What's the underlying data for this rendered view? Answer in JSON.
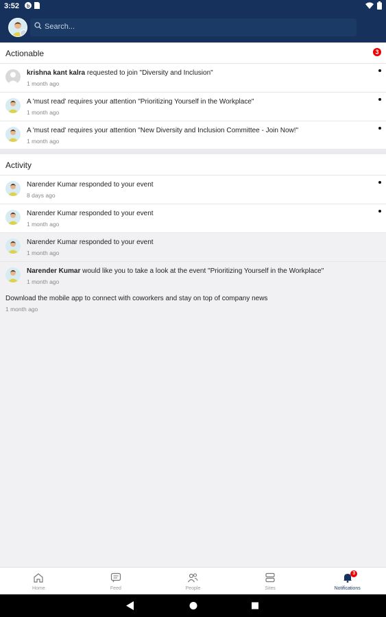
{
  "status_bar": {
    "time": "3:52"
  },
  "search": {
    "placeholder": "Search..."
  },
  "actionable": {
    "title": "Actionable",
    "count": "3",
    "items": [
      {
        "actor": "krishna kant kalra",
        "text": " requested to join \"Diversity and Inclusion\"",
        "time": "1 month ago",
        "unread": true
      },
      {
        "actor": "",
        "text": "A 'must read' requires your attention \"Prioritizing Yourself in the Workplace\"",
        "time": "1 month ago",
        "unread": true
      },
      {
        "actor": "",
        "text": "A 'must read' requires your attention \"New Diversity and Inclusion Committee - Join Now!\"",
        "time": "1 month ago",
        "unread": true
      }
    ]
  },
  "activity": {
    "title": "Activity",
    "items": [
      {
        "text": "Narender Kumar responded to your event",
        "time": "8 days ago",
        "unread": true
      },
      {
        "text": "Narender Kumar responded to your event",
        "time": "1 month ago",
        "unread": true
      },
      {
        "text": "Narender Kumar responded to your event",
        "time": "1 month ago",
        "unread": false
      },
      {
        "actor": "Narender Kumar",
        "text": " would like you to take a look at the event \"Prioritizing Yourself in the Workplace\"",
        "time": "1 month ago",
        "unread": false
      },
      {
        "text": "Download the mobile app to connect with coworkers and stay on top of company news",
        "time": "1 month ago",
        "unread": false
      }
    ]
  },
  "bottom_nav": {
    "items": [
      {
        "label": "Home",
        "icon": "home-icon"
      },
      {
        "label": "Feed",
        "icon": "feed-icon"
      },
      {
        "label": "People",
        "icon": "people-icon"
      },
      {
        "label": "Sites",
        "icon": "sites-icon"
      },
      {
        "label": "Notifications",
        "icon": "bell-icon",
        "badge": "3",
        "active": true
      }
    ]
  },
  "colors": {
    "header": "#16325c",
    "badge": "#ee0000",
    "unread_dot": "#111111"
  }
}
